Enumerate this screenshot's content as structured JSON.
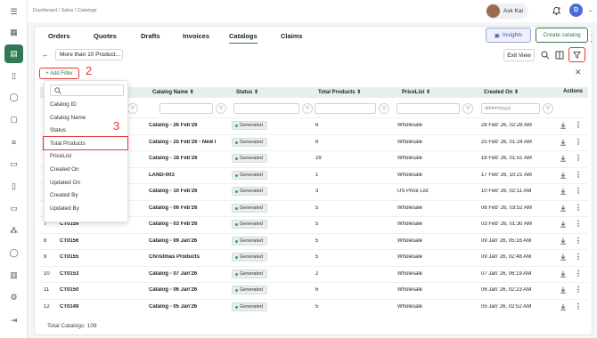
{
  "breadcrumb": "Dashboard  /  Sales  /  Catalogs",
  "user": {
    "name": "Ask Kai",
    "avatar_letter": "D"
  },
  "tabs": [
    {
      "label": "Orders"
    },
    {
      "label": "Quotes"
    },
    {
      "label": "Drafts"
    },
    {
      "label": "Invoices"
    },
    {
      "label": "Catalogs",
      "active": true
    },
    {
      "label": "Claims"
    }
  ],
  "actions": {
    "insights": "Insights",
    "create": "Create catalog",
    "exit_view": "Exit View"
  },
  "filter_chip": "More than 10 Product...",
  "add_filter": "+ Add Filter",
  "annotations": {
    "n1": "1",
    "n2": "2",
    "n3": "3"
  },
  "columns": {
    "catalog_id": "Catalog ID",
    "catalog_name": "Catalog Name",
    "status": "Status",
    "total_products": "Total Products",
    "pricelist": "PriceList",
    "created_on": "Created On",
    "actions": "Actions"
  },
  "date_placeholder": "dd/mm/yyyy",
  "rows": [
    {
      "num": "1",
      "id": "",
      "name": "Catalog - 26 Feb'26",
      "status": "Generated",
      "total": "6",
      "pricelist": "Wholesale",
      "created": "26 Feb' 26, 02:28 AM"
    },
    {
      "num": "2",
      "id": "",
      "name": "Catalog - 25 Feb'26 - New I",
      "status": "Generated",
      "total": "6",
      "pricelist": "Wholesale",
      "created": "25 Feb' 26, 01:24 AM"
    },
    {
      "num": "3",
      "id": "",
      "name": "Catalog - 18 Feb'26",
      "status": "Generated",
      "total": "29",
      "pricelist": "Wholesale",
      "created": "18 Feb' 26, 01:51 AM"
    },
    {
      "num": "4",
      "id": "",
      "name": "LAND-003",
      "status": "Generated",
      "total": "1",
      "pricelist": "Wholesale",
      "created": "17 Feb' 26, 10:21 AM"
    },
    {
      "num": "5",
      "id": "",
      "name": "Catalog - 10 Feb'26",
      "status": "Generated",
      "total": "3",
      "pricelist": "US Price List",
      "created": "10 Feb' 26, 02:11 AM"
    },
    {
      "num": "6",
      "id": "",
      "name": "Catalog - 06 Feb'26",
      "status": "Generated",
      "total": "5",
      "pricelist": "Wholesale",
      "created": "06 Feb' 26, 03:52 AM"
    },
    {
      "num": "7",
      "id": "CT0159",
      "name": "Catalog - 03 Feb'26",
      "status": "Generated",
      "total": "5",
      "pricelist": "Wholesale",
      "created": "03 Feb' 26, 01:30 AM"
    },
    {
      "num": "8",
      "id": "CT0156",
      "name": "Catalog - 09 Jan'26",
      "status": "Generated",
      "total": "5",
      "pricelist": "Wholesale",
      "created": "09 Jan' 26, 05:16 AM"
    },
    {
      "num": "9",
      "id": "CT0155",
      "name": "Christmas Products",
      "status": "Generated",
      "total": "5",
      "pricelist": "Wholesale",
      "created": "09 Jan' 26, 02:48 AM"
    },
    {
      "num": "10",
      "id": "CT0153",
      "name": "Catalog - 07 Jan'26",
      "status": "Generated",
      "total": "2",
      "pricelist": "Wholesale",
      "created": "07 Jan' 26, 06:19 AM"
    },
    {
      "num": "11",
      "id": "CT0150",
      "name": "Catalog - 06 Jan'26",
      "status": "Generated",
      "total": "6",
      "pricelist": "Wholesale",
      "created": "06 Jan' 26, 02:23 AM"
    },
    {
      "num": "12",
      "id": "CT0149",
      "name": "Catalog - 05 Jan'26",
      "status": "Generated",
      "total": "5",
      "pricelist": "Wholesale",
      "created": "05 Jan' 26, 02:52 AM"
    }
  ],
  "dropdown_items": [
    "Catalog ID",
    "Catalog Name",
    "Status",
    "Total Products",
    "PriceList",
    "Created On",
    "Updated On",
    "Created By",
    "Updated By"
  ],
  "footer": "Total Catalogs: 108",
  "colors": {
    "accent": "#2f7a52",
    "highlight": "#e53935",
    "header_bg": "#e6f0e9"
  }
}
